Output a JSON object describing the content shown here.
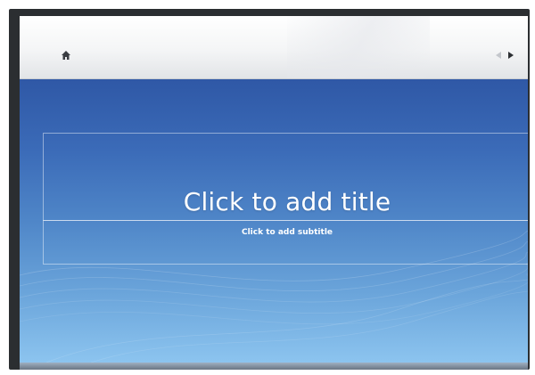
{
  "slide": {
    "title_placeholder": "Click to add title",
    "subtitle_placeholder": "Click to add subtitle"
  },
  "icons": {
    "home": "home-icon",
    "previous": "previous-icon",
    "next": "next-icon"
  },
  "colors": {
    "slide_top": "#2f58a6",
    "slide_bottom": "#8cc4ef",
    "header_bar": "#f4f5f6",
    "frame": "#2b2e31"
  }
}
